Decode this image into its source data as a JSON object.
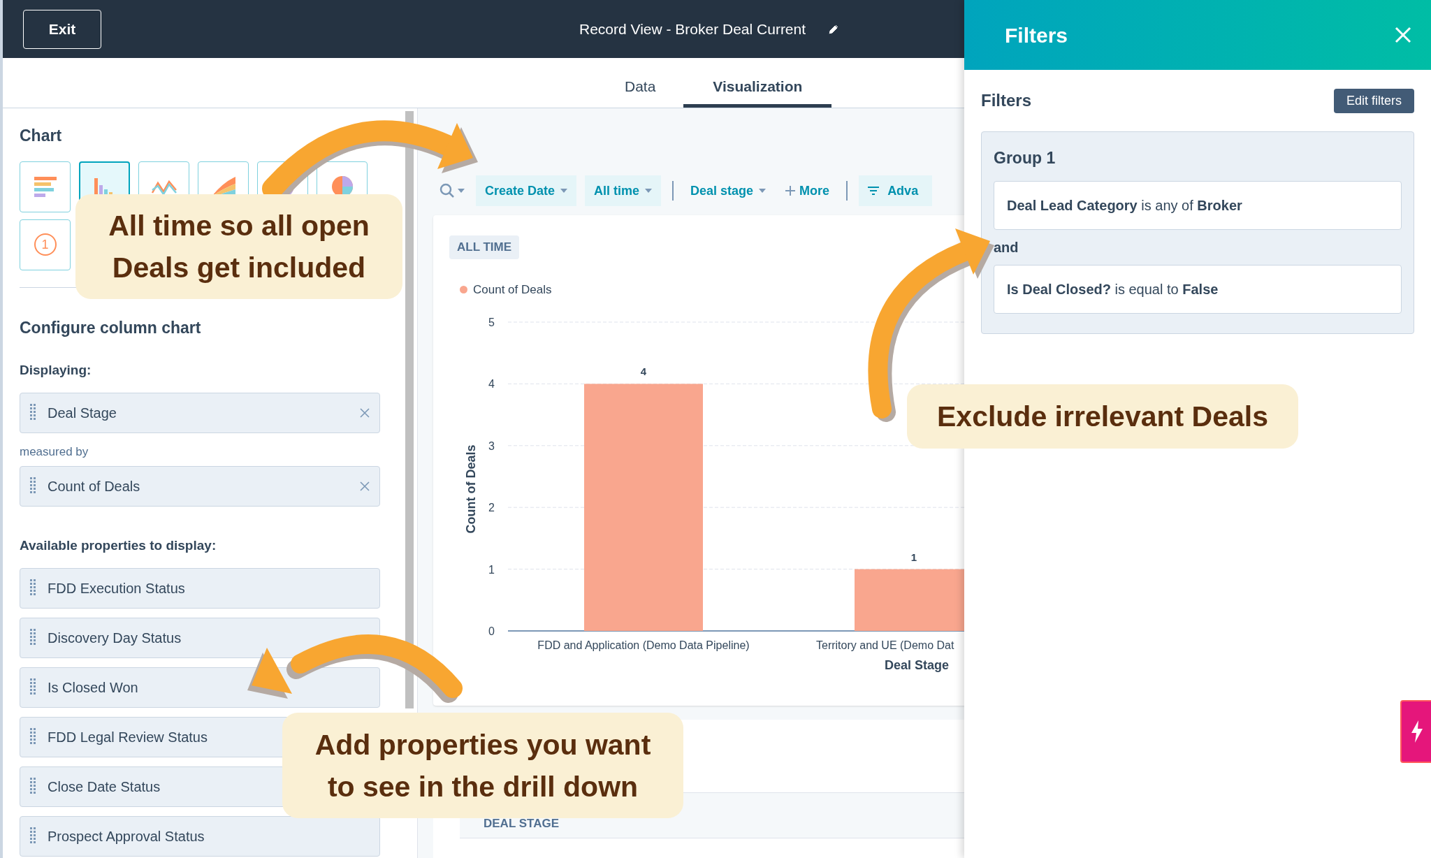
{
  "top_bar": {
    "exit_label": "Exit",
    "title": "Record View - Broker Deal Current"
  },
  "tabs": [
    {
      "label": "Data",
      "selected": false
    },
    {
      "label": "Visualization",
      "selected": true
    }
  ],
  "chart_panel": {
    "heading": "Chart",
    "chart_types": [
      {
        "kind": "bar",
        "selected": false
      },
      {
        "kind": "column",
        "selected": true
      },
      {
        "kind": "line",
        "selected": false
      },
      {
        "kind": "area",
        "selected": false
      },
      {
        "kind": "donut",
        "selected": false
      },
      {
        "kind": "pie",
        "selected": false
      },
      {
        "kind": "kpi",
        "label": "1",
        "selected": false
      }
    ],
    "configure_heading": "Configure column chart",
    "displaying_label": "Displaying:",
    "dimension": "Deal Stage",
    "connector": "measured by",
    "measure": "Count of Deals",
    "available_heading": "Available properties to display:",
    "available_properties": [
      "FDD Execution Status",
      "Discovery Day Status",
      "Is Closed Won",
      "FDD Legal Review Status",
      "Close Date Status",
      "Prospect Approval Status"
    ]
  },
  "toolbar": [
    {
      "kind": "search"
    },
    {
      "kind": "chip",
      "label": "Create Date"
    },
    {
      "kind": "chip",
      "label": "All time"
    },
    {
      "kind": "link",
      "label": "Deal stage",
      "divider_before": true
    },
    {
      "kind": "more",
      "label": "More"
    },
    {
      "kind": "advanced",
      "label": "Adva",
      "divider_before": true
    }
  ],
  "chart_card": {
    "badge": "ALL TIME",
    "chart_data": {
      "type": "bar",
      "categories": [
        "FDD and Application (Demo Data Pipeline)",
        "Territory and UE (Demo Dat"
      ],
      "xlabel": "Deal Stage",
      "ylabel": "Count of Deals",
      "ylim": [
        0,
        5
      ],
      "yticks": [
        0,
        1,
        2,
        3,
        4,
        5
      ],
      "data_labels": true,
      "grid": true,
      "series": [
        {
          "name": "Count of Deals",
          "color": "#f9a68e",
          "values": [
            4,
            1
          ]
        }
      ]
    }
  },
  "table": {
    "columns": [
      "DEAL STAGE"
    ]
  },
  "filters_panel": {
    "title": "Filters",
    "subtitle": "Filters",
    "edit_label": "Edit filters",
    "group": {
      "title": "Group 1",
      "joiner": "and",
      "conditions": [
        "**Deal Lead Category** is any of **Broker**",
        "**Is Deal Closed?** is equal to **False**"
      ]
    }
  },
  "annotations": [
    {
      "text": "All time so all open\nDeals get included"
    },
    {
      "text": "Exclude irrelevant Deals"
    },
    {
      "text": "Add properties you want\nto see in the drill down"
    }
  ]
}
